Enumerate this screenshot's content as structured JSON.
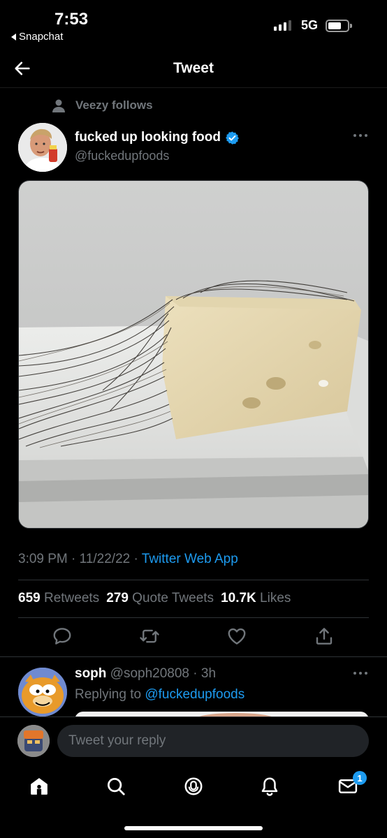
{
  "status_bar": {
    "time": "7:53",
    "back_app": "Snapchat",
    "network": "5G"
  },
  "header": {
    "title": "Tweet"
  },
  "tweet": {
    "social_context": "Veezy follows",
    "author_name": "fucked up looking food",
    "author_handle": "@fuckedupfoods",
    "verified": true,
    "time": "3:09 PM",
    "date": "11/22/22",
    "source": "Twitter Web App",
    "stats": {
      "retweets_count": "659",
      "retweets_label": "Retweets",
      "quotes_count": "279",
      "quotes_label": "Quote Tweets",
      "likes_count": "10.7K",
      "likes_label": "Likes"
    }
  },
  "reply": {
    "name": "soph",
    "handle": "@soph20808",
    "age": "3h",
    "replying_prefix": "Replying to",
    "replying_to": "@fuckedupfoods"
  },
  "composer": {
    "placeholder": "Tweet your reply"
  },
  "tabbar": {
    "messages_badge": "1"
  },
  "colors": {
    "accent": "#1d9bf0",
    "background": "#000000",
    "muted": "#71767b",
    "divider": "#2f3336"
  }
}
